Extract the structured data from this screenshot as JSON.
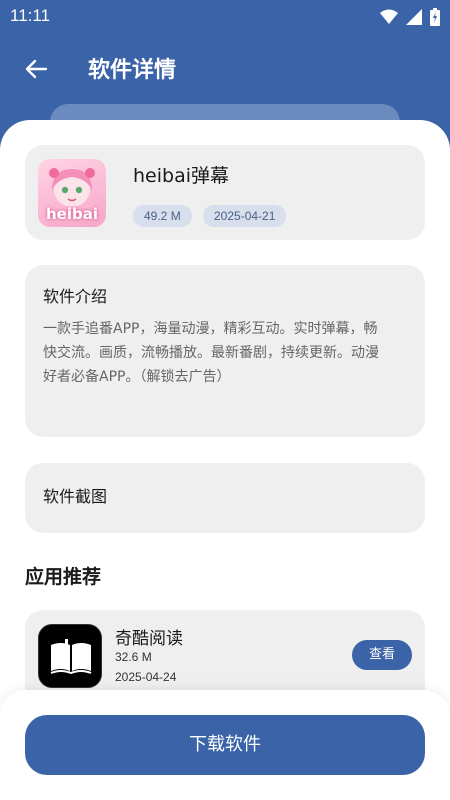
{
  "status_bar": {
    "time": "11:11",
    "icons": [
      "wifi-icon",
      "signal-icon",
      "battery-icon"
    ]
  },
  "toolbar": {
    "title": "软件详情",
    "back_icon": "arrow-left-icon"
  },
  "app": {
    "name": "heibai弹幕",
    "size": "49.2 M",
    "date": "2025-04-21",
    "icon_text": "heibai"
  },
  "intro": {
    "title": "软件介绍",
    "lines": [
      "一款手追番APP，海量动漫，精彩互动。实时弹幕，畅",
      "快交流。画质，流畅播放。最新番剧，持续更新。动漫",
      "好者必备APP。（解锁去广告）"
    ]
  },
  "screenshots": {
    "title": "软件截图"
  },
  "recommend": {
    "title": "应用推荐",
    "items": [
      {
        "name": "奇酷阅读",
        "size": "32.6 M",
        "date": "2025-04-24",
        "button": "查看"
      }
    ]
  },
  "download": {
    "label": "下载软件"
  },
  "colors": {
    "primary": "#3a63a8",
    "card_bg": "#efefef",
    "chip_bg": "#d7dfec"
  }
}
